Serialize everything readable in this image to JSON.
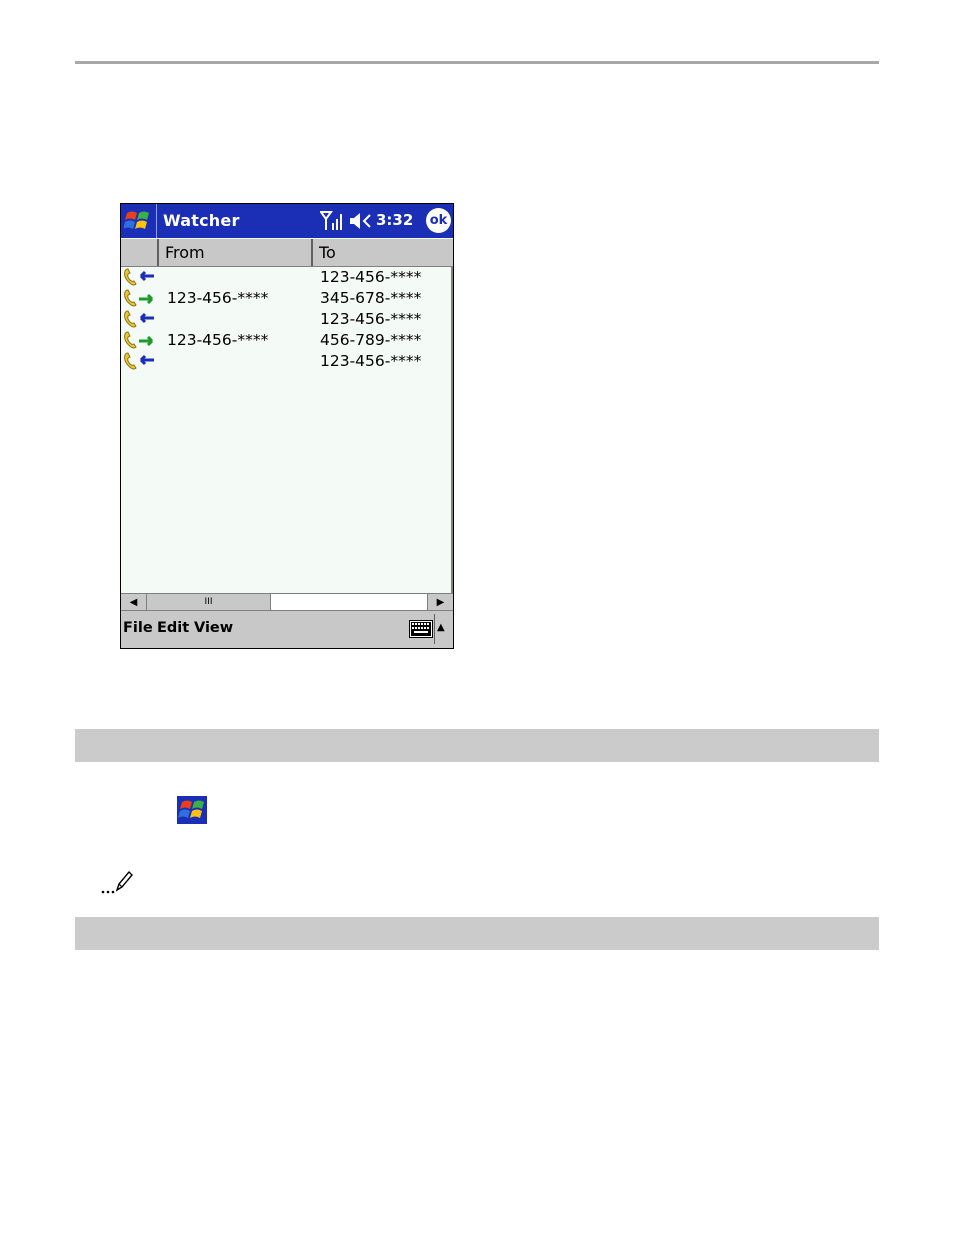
{
  "window": {
    "title": "Watcher",
    "clock": "3:32",
    "ok_label": "ok",
    "titlebar_color": "#1a2fb5"
  },
  "table": {
    "headers": [
      "",
      "From",
      "To"
    ],
    "rows": [
      {
        "direction": "incoming",
        "from": "",
        "to": "123-456-****"
      },
      {
        "direction": "outgoing",
        "from": "123-456-****",
        "to": "345-678-****"
      },
      {
        "direction": "incoming",
        "from": "",
        "to": "123-456-****"
      },
      {
        "direction": "outgoing",
        "from": "123-456-****",
        "to": "456-789-****"
      },
      {
        "direction": "incoming",
        "from": "",
        "to": "123-456-****"
      }
    ]
  },
  "scrollbar": {
    "thumb_glyph": "III"
  },
  "menubar": {
    "items": [
      "File",
      "Edit",
      "View"
    ]
  },
  "icons": {
    "start": "windows-flag-icon",
    "signal": "signal-strength-icon",
    "speaker": "speaker-muted-icon",
    "incoming_call": "incoming-call-icon",
    "outgoing_call": "outgoing-call-icon",
    "keyboard": "keyboard-icon",
    "note": "note-pencil-icon"
  }
}
